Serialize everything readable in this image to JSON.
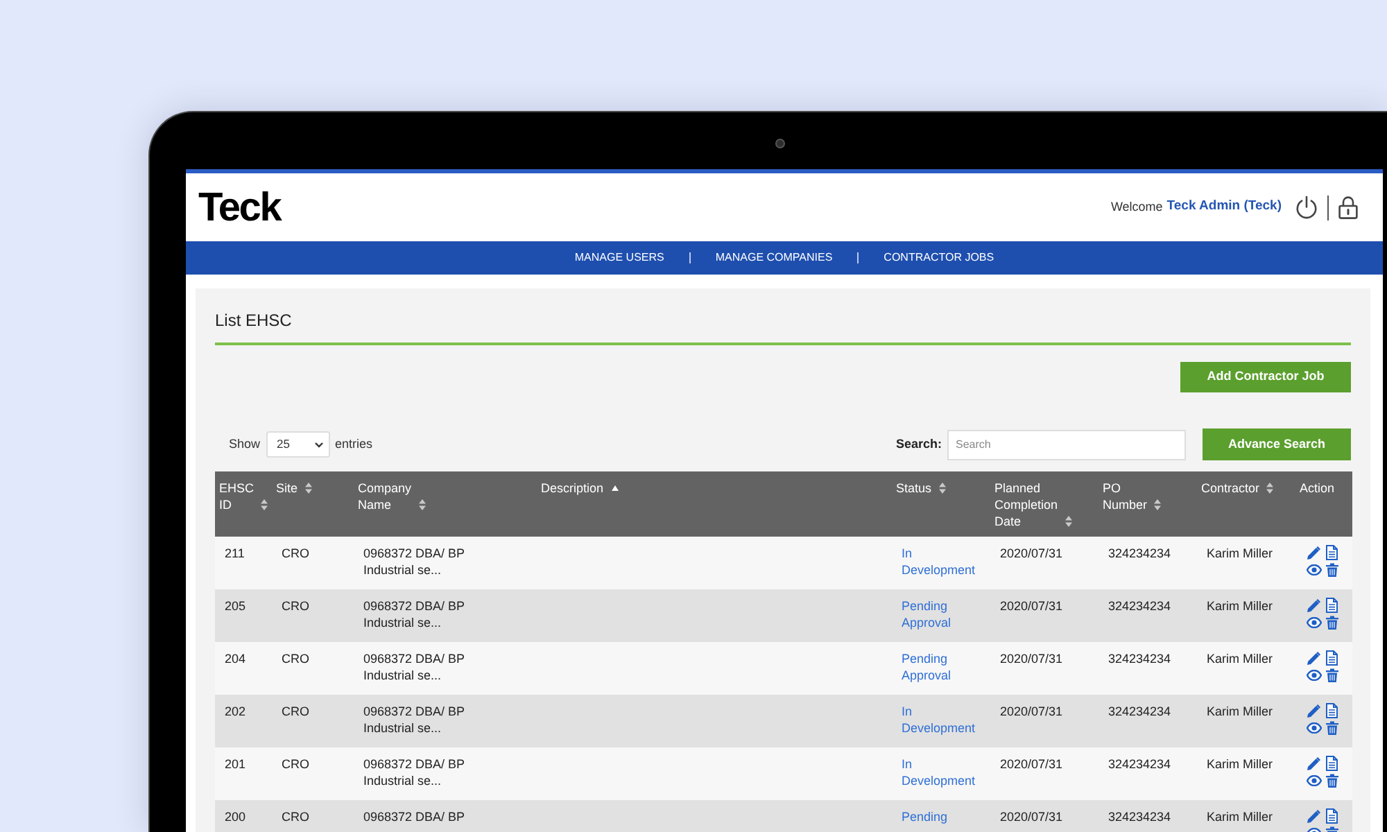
{
  "header": {
    "logo": "Teck",
    "welcome": "Welcome",
    "user": "Teck Admin (Teck)"
  },
  "nav": [
    {
      "label": "MANAGE USERS"
    },
    {
      "label": "MANAGE COMPANIES"
    },
    {
      "label": "CONTRACTOR JOBS"
    }
  ],
  "page": {
    "title": "List EHSC",
    "add_button": "Add Contractor Job",
    "show_label": "Show",
    "page_length": "25",
    "entries_label": "entries",
    "search_label": "Search:",
    "search_placeholder": "Search",
    "advance_button": "Advance Search"
  },
  "table": {
    "columns": [
      {
        "label": "EHSC ID",
        "kind": "sortable"
      },
      {
        "label": "Site",
        "kind": "sortable"
      },
      {
        "label": "Company Name",
        "kind": "sortable"
      },
      {
        "label": "Description",
        "kind": "ascending"
      },
      {
        "label": "Status",
        "kind": "sortable"
      },
      {
        "label": "Planned Completion Date",
        "kind": "sortable"
      },
      {
        "label": "PO Number",
        "kind": "sortable"
      },
      {
        "label": "Contractor",
        "kind": "sortable"
      },
      {
        "label": "Action",
        "kind": "plain"
      }
    ],
    "rows": [
      {
        "ehsc_id": "211",
        "site": "CRO",
        "company": "0968372 DBA/ BP Industrial se...",
        "status": "In Development",
        "completion_date": "2020/07/31",
        "po_number": "324234234",
        "contractor": "Karim Miller"
      },
      {
        "ehsc_id": "205",
        "site": "CRO",
        "company": "0968372 DBA/ BP Industrial se...",
        "status": "Pending Approval",
        "completion_date": "2020/07/31",
        "po_number": "324234234",
        "contractor": "Karim Miller"
      },
      {
        "ehsc_id": "204",
        "site": "CRO",
        "company": "0968372 DBA/ BP Industrial se...",
        "status": "Pending Approval",
        "completion_date": "2020/07/31",
        "po_number": "324234234",
        "contractor": "Karim Miller"
      },
      {
        "ehsc_id": "202",
        "site": "CRO",
        "company": "0968372 DBA/ BP Industrial se...",
        "status": "In Development",
        "completion_date": "2020/07/31",
        "po_number": "324234234",
        "contractor": "Karim Miller"
      },
      {
        "ehsc_id": "201",
        "site": "CRO",
        "company": "0968372 DBA/ BP Industrial se...",
        "status": "In Development",
        "completion_date": "2020/07/31",
        "po_number": "324234234",
        "contractor": "Karim Miller"
      },
      {
        "ehsc_id": "200",
        "site": "CRO",
        "company": "0968372 DBA/ BP",
        "status": "Pending",
        "completion_date": "2020/07/31",
        "po_number": "324234234",
        "contractor": "Karim Miller"
      }
    ]
  }
}
